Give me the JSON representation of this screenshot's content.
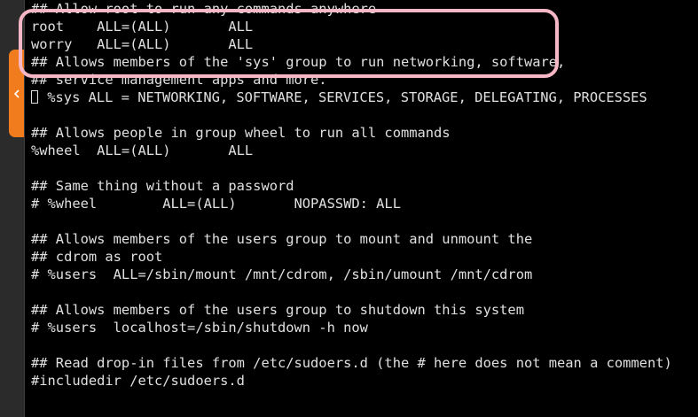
{
  "editor": {
    "lines": [
      "## Allow root to run any commands anywhere",
      "root    ALL=(ALL)       ALL",
      "worry   ALL=(ALL)       ALL",
      "## Allows members of the 'sys' group to run networking, software,",
      "## service management apps and more.",
      " %sys ALL = NETWORKING, SOFTWARE, SERVICES, STORAGE, DELEGATING, PROCESSES",
      "",
      "## Allows people in group wheel to run all commands",
      "%wheel  ALL=(ALL)       ALL",
      "",
      "## Same thing without a password",
      "# %wheel        ALL=(ALL)       NOPASSWD: ALL",
      "",
      "## Allows members of the users group to mount and unmount the",
      "## cdrom as root",
      "# %users  ALL=/sbin/mount /mnt/cdrom, /sbin/umount /mnt/cdrom",
      "",
      "## Allows members of the users group to shutdown this system",
      "# %users  localhost=/sbin/shutdown -h now",
      "",
      "## Read drop-in files from /etc/sudoers.d (the # here does not mean a comment)",
      "#includedir /etc/sudoers.d"
    ],
    "cursor_line": 5
  },
  "sidebar": {
    "collapse_icon": "chevron-left-icon",
    "collapse_color": "#f07c1e"
  },
  "annotation": {
    "color": "#f5b7c6"
  }
}
